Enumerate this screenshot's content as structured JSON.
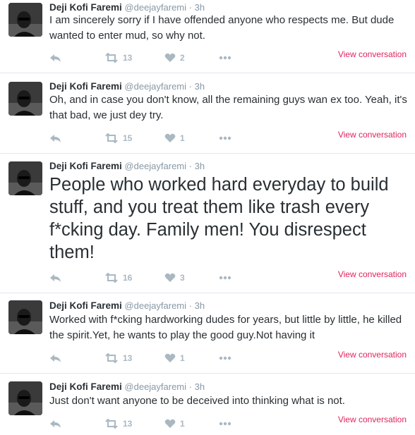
{
  "tweets": [
    {
      "fullname": "Deji Kofi Faremi",
      "username": "@deejayfaremi",
      "dot": "·",
      "time": "3h",
      "text": "I am sincerely sorry if I have offended anyone who respects me. But dude wanted to enter mud, so why not.",
      "retweets": "13",
      "likes": "2",
      "view_conversation": "View conversation"
    },
    {
      "fullname": "Deji Kofi Faremi",
      "username": "@deejayfaremi",
      "dot": "·",
      "time": "3h",
      "text": "Oh, and in case you don't know, all the remaining guys wan ex too. Yeah, it's that bad, we just dey try.",
      "retweets": "15",
      "likes": "1",
      "view_conversation": "View conversation"
    },
    {
      "fullname": "Deji Kofi Faremi",
      "username": "@deejayfaremi",
      "dot": "·",
      "time": "3h",
      "text": "People who worked hard everyday to build stuff, and you treat them like trash every f*cking day. Family men! You disrespect them!",
      "retweets": "16",
      "likes": "3",
      "view_conversation": "View conversation"
    },
    {
      "fullname": "Deji Kofi Faremi",
      "username": "@deejayfaremi",
      "dot": "·",
      "time": "3h",
      "text": "Worked with f*cking hardworking dudes for years, but little by little, he killed the spirit.Yet, he wants to play the good guy.Not having it",
      "retweets": "13",
      "likes": "1",
      "view_conversation": "View conversation"
    },
    {
      "fullname": "Deji Kofi Faremi",
      "username": "@deejayfaremi",
      "dot": "·",
      "time": "3h",
      "text": "Just don't want anyone to be deceived into thinking what is not.",
      "retweets": "13",
      "likes": "1",
      "view_conversation": "View conversation"
    }
  ],
  "icons": {
    "reply": "reply-icon",
    "retweet": "retweet-icon",
    "like": "heart-icon",
    "more": "more-icon"
  },
  "colors": {
    "name": "#292f33",
    "meta": "#8899a6",
    "action": "#aab8c2",
    "link": "#e0245e",
    "divider": "#e1e8ed"
  }
}
